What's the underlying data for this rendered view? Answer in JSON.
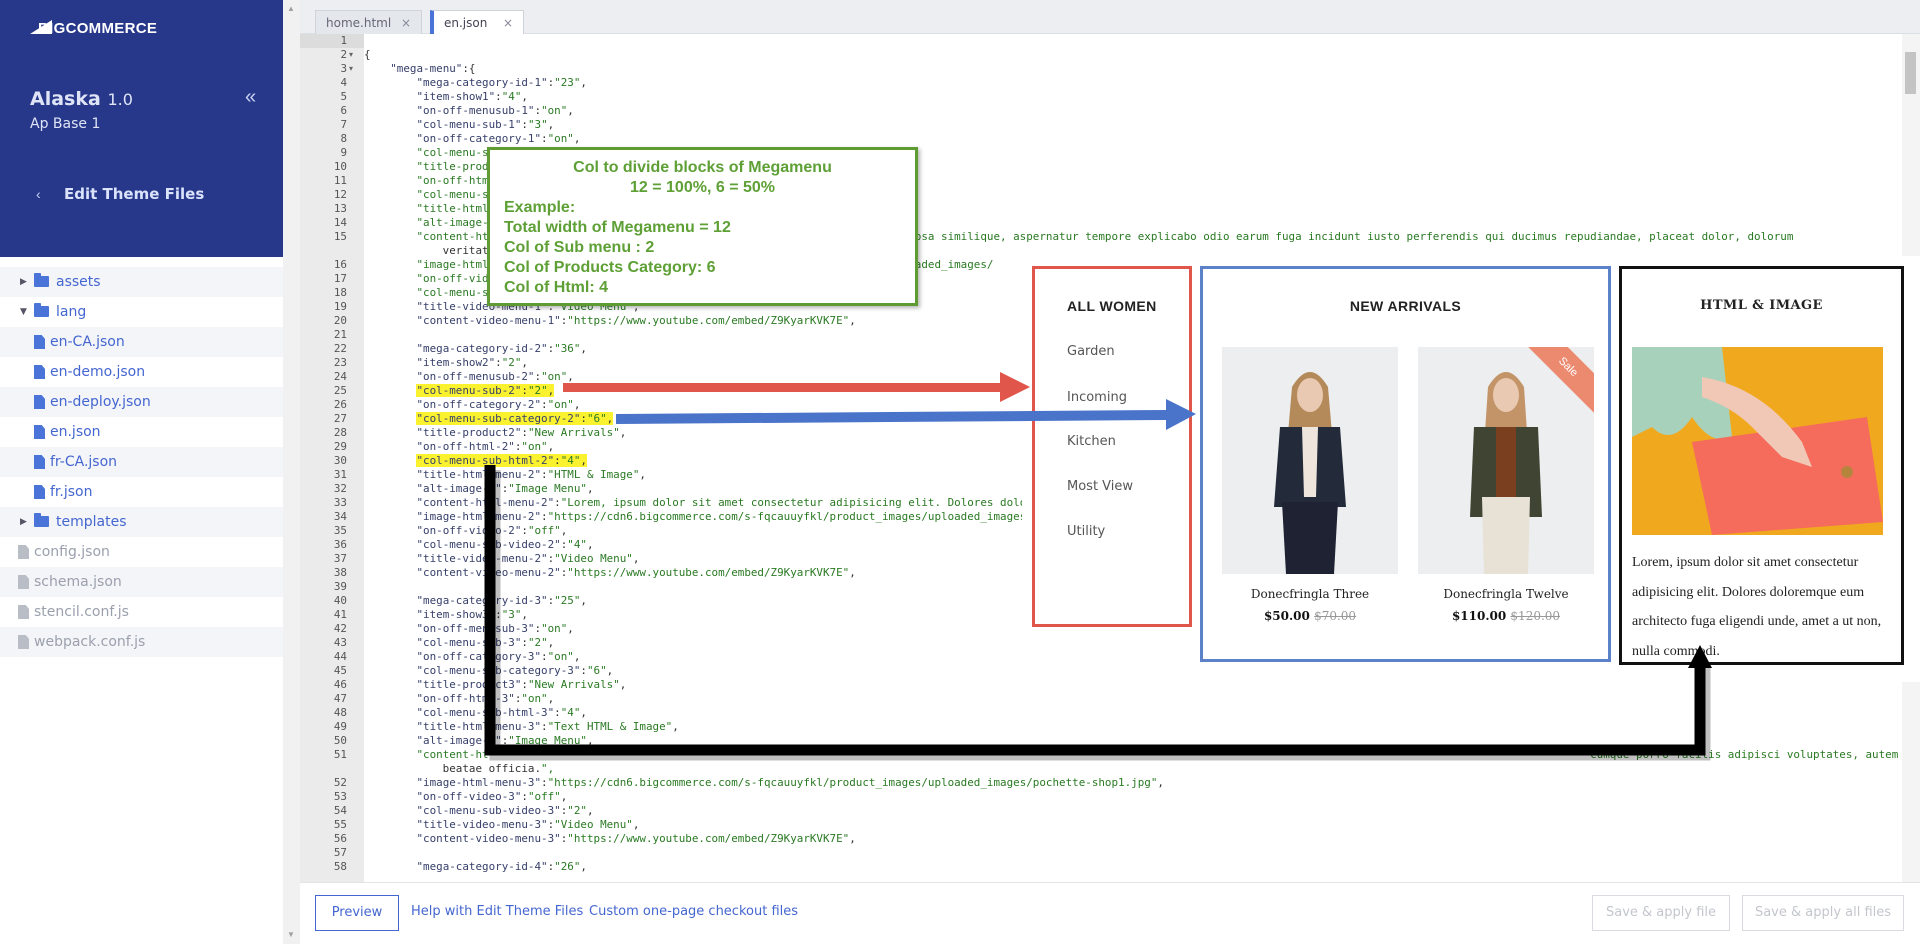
{
  "sidebar": {
    "brand": "BIGCOMMERCE",
    "theme_name": "Alaska",
    "theme_version": "1.0",
    "variation": "Ap Base 1",
    "collapse_icon": "double-chevron-left-icon",
    "back_icon": "chevron-left-icon",
    "back_label": "Edit Theme Files",
    "tree": [
      {
        "label": "assets",
        "type": "folder",
        "level": 0,
        "expanded": false
      },
      {
        "label": "lang",
        "type": "folder",
        "level": 0,
        "expanded": true
      },
      {
        "label": "en-CA.json",
        "type": "file",
        "level": 1
      },
      {
        "label": "en-demo.json",
        "type": "file",
        "level": 1
      },
      {
        "label": "en-deploy.json",
        "type": "file",
        "level": 1
      },
      {
        "label": "en.json",
        "type": "file",
        "level": 1
      },
      {
        "label": "fr-CA.json",
        "type": "file",
        "level": 1
      },
      {
        "label": "fr.json",
        "type": "file",
        "level": 1
      },
      {
        "label": "templates",
        "type": "folder",
        "level": 0,
        "expanded": false
      },
      {
        "label": "config.json",
        "type": "file",
        "level": 0,
        "muted": true
      },
      {
        "label": "schema.json",
        "type": "file",
        "level": 0,
        "muted": true
      },
      {
        "label": "stencil.conf.js",
        "type": "file",
        "level": 0,
        "muted": true
      },
      {
        "label": "webpack.conf.js",
        "type": "file",
        "level": 0,
        "muted": true
      }
    ]
  },
  "tabs": [
    {
      "label": "home.html",
      "active": false
    },
    {
      "label": "en.json",
      "active": true
    }
  ],
  "editor": {
    "highlighted_lines": [
      "25",
      "27",
      "30"
    ],
    "lines": [
      {
        "n": "1",
        "text": ""
      },
      {
        "n": "2",
        "text": "{",
        "fold": true
      },
      {
        "n": "3",
        "text": "    \"mega-menu\":{",
        "fold": true
      },
      {
        "n": "4",
        "text": "        \"mega-category-id-1\":\"23\","
      },
      {
        "n": "5",
        "text": "        \"item-show1\":\"4\","
      },
      {
        "n": "6",
        "text": "        \"on-off-menusub-1\":\"on\","
      },
      {
        "n": "7",
        "text": "        \"col-menu-sub-1\":\"3\","
      },
      {
        "n": "8",
        "text": "        \"on-off-category-1\":\"on\","
      },
      {
        "n": "9",
        "text": "        \"col-menu-s"
      },
      {
        "n": "10",
        "text": "        \"title-prod"
      },
      {
        "n": "11",
        "text": "        \"on-off-htm"
      },
      {
        "n": "12",
        "text": "        \"col-menu-s"
      },
      {
        "n": "13",
        "text": "        \"title-html"
      },
      {
        "n": "14",
        "text": "        \"alt-image-"
      },
      {
        "n": "15",
        "text": "        \"content-ht                                                           lit. Ipsa similique, aspernatur tempore explicabo odio earum fuga incidunt iusto perferendis qui ducimus repudiandae, placeat dolor, dolorum"
      },
      {
        "n": "",
        "text": "            veritat"
      },
      {
        "n": "16",
        "text": "        \"image-html                                                           s/uploaded_images/"
      },
      {
        "n": "17",
        "text": "        \"on-off-vid"
      },
      {
        "n": "18",
        "text": "        \"col-menu-s"
      },
      {
        "n": "19",
        "text": "        \"title-video-menu-1\":\"Video Menu\","
      },
      {
        "n": "20",
        "text": "        \"content-video-menu-1\":\"https://www.youtube.com/embed/Z9KyarKVK7E\","
      },
      {
        "n": "21",
        "text": ""
      },
      {
        "n": "22",
        "text": "        \"mega-category-id-2\":\"36\","
      },
      {
        "n": "23",
        "text": "        \"item-show2\":\"2\","
      },
      {
        "n": "24",
        "text": "        \"on-off-menusub-2\":\"on\","
      },
      {
        "n": "25",
        "text": "        \"col-menu-sub-2\":\"2\","
      },
      {
        "n": "26",
        "text": "        \"on-off-category-2\":\"on\","
      },
      {
        "n": "27",
        "text": "        \"col-menu-sub-category-2\":\"6\","
      },
      {
        "n": "28",
        "text": "        \"title-product2\":\"New Arrivals\","
      },
      {
        "n": "29",
        "text": "        \"on-off-html-2\":\"on\","
      },
      {
        "n": "30",
        "text": "        \"col-menu-sub-html-2\":\"4\","
      },
      {
        "n": "31",
        "text": "        \"title-html-menu-2\":\"HTML & Image\","
      },
      {
        "n": "32",
        "text": "        \"alt-image-2\":\"Image Menu\","
      },
      {
        "n": "33",
        "text": "        \"content-html-menu-2\":\"Lorem, ipsum dolor sit amet consectetur adipisicing elit. Dolores dolor"
      },
      {
        "n": "34",
        "text": "        \"image-html-menu-2\":\"https://cdn6.bigcommerce.com/s-fqcauuyfkl/product_images/uploaded_images/"
      },
      {
        "n": "35",
        "text": "        \"on-off-video-2\":\"off\","
      },
      {
        "n": "36",
        "text": "        \"col-menu-sub-video-2\":\"4\","
      },
      {
        "n": "37",
        "text": "        \"title-video-menu-2\":\"Video Menu\","
      },
      {
        "n": "38",
        "text": "        \"content-video-menu-2\":\"https://www.youtube.com/embed/Z9KyarKVK7E\","
      },
      {
        "n": "39",
        "text": ""
      },
      {
        "n": "40",
        "text": "        \"mega-category-id-3\":\"25\","
      },
      {
        "n": "41",
        "text": "        \"item-show3\":\"3\","
      },
      {
        "n": "42",
        "text": "        \"on-off-menusub-3\":\"on\","
      },
      {
        "n": "43",
        "text": "        \"col-menu-sub-3\":\"2\","
      },
      {
        "n": "44",
        "text": "        \"on-off-category-3\":\"on\","
      },
      {
        "n": "45",
        "text": "        \"col-menu-sub-category-3\":\"6\","
      },
      {
        "n": "46",
        "text": "        \"title-product3\":\"New Arrivals\","
      },
      {
        "n": "47",
        "text": "        \"on-off-html-3\":\"on\","
      },
      {
        "n": "48",
        "text": "        \"col-menu-sub-html-3\":\"4\","
      },
      {
        "n": "49",
        "text": "        \"title-html-menu-3\":\"Text HTML & Image\","
      },
      {
        "n": "50",
        "text": "        \"alt-image-3\":\"Image Menu\","
      },
      {
        "n": "51",
        "text": "        \"content-ht                                                                                                                                                                        cumque porro facilis adipisci voluptates, autem"
      },
      {
        "n": "",
        "text": "            beatae officia.\","
      },
      {
        "n": "52",
        "text": "        \"image-html-menu-3\":\"https://cdn6.bigcommerce.com/s-fqcauuyfkl/product_images/uploaded_images/pochette-shop1.jpg\","
      },
      {
        "n": "53",
        "text": "        \"on-off-video-3\":\"off\","
      },
      {
        "n": "54",
        "text": "        \"col-menu-sub-video-3\":\"2\","
      },
      {
        "n": "55",
        "text": "        \"title-video-menu-3\":\"Video Menu\","
      },
      {
        "n": "56",
        "text": "        \"content-video-menu-3\":\"https://www.youtube.com/embed/Z9KyarKVK7E\","
      },
      {
        "n": "57",
        "text": ""
      },
      {
        "n": "58",
        "text": "        \"mega-category-id-4\":\"26\","
      }
    ]
  },
  "annotation": {
    "title": "Col to divide blocks of Megamenu",
    "subtitle": "12 = 100%, 6 = 50%",
    "lines": [
      "Example:",
      "Total width of Megamenu = 12",
      "Col of Sub menu : 2",
      "Col of Products Category: 6",
      "Col of Html: 4"
    ]
  },
  "megamenu": {
    "submenu": {
      "title": "ALL WOMEN",
      "items": [
        "Garden",
        "Incoming",
        "Kitchen",
        "Most View",
        "Utility"
      ]
    },
    "products": {
      "title": "NEW ARRIVALS",
      "items": [
        {
          "name": "Donecfringla Three",
          "price": "$50.00",
          "old_price": "$70.00",
          "badge": ""
        },
        {
          "name": "Donecfringla Twelve",
          "price": "$110.00",
          "old_price": "$120.00",
          "badge": "Sale"
        }
      ]
    },
    "html": {
      "title": "HTML & IMAGE",
      "text": "Lorem, ipsum dolor sit amet consectetur adipisicing elit. Dolores doloremque eum architecto fuga eligendi unde, amet a ut non, nulla commodi."
    }
  },
  "footer": {
    "preview": "Preview",
    "help_link": "Help with Edit Theme Files",
    "checkout_link": "Custom one-page checkout files",
    "save_file": "Save & apply file",
    "save_all": "Save & apply all files"
  },
  "colors": {
    "sidebar_header": "#27388b",
    "link": "#4466d0",
    "annotation_green": "#5e9c33",
    "submenu_box": "#e0564b",
    "products_box": "#5b81c8",
    "html_box": "#111111",
    "highlight": "#fbf22f"
  }
}
